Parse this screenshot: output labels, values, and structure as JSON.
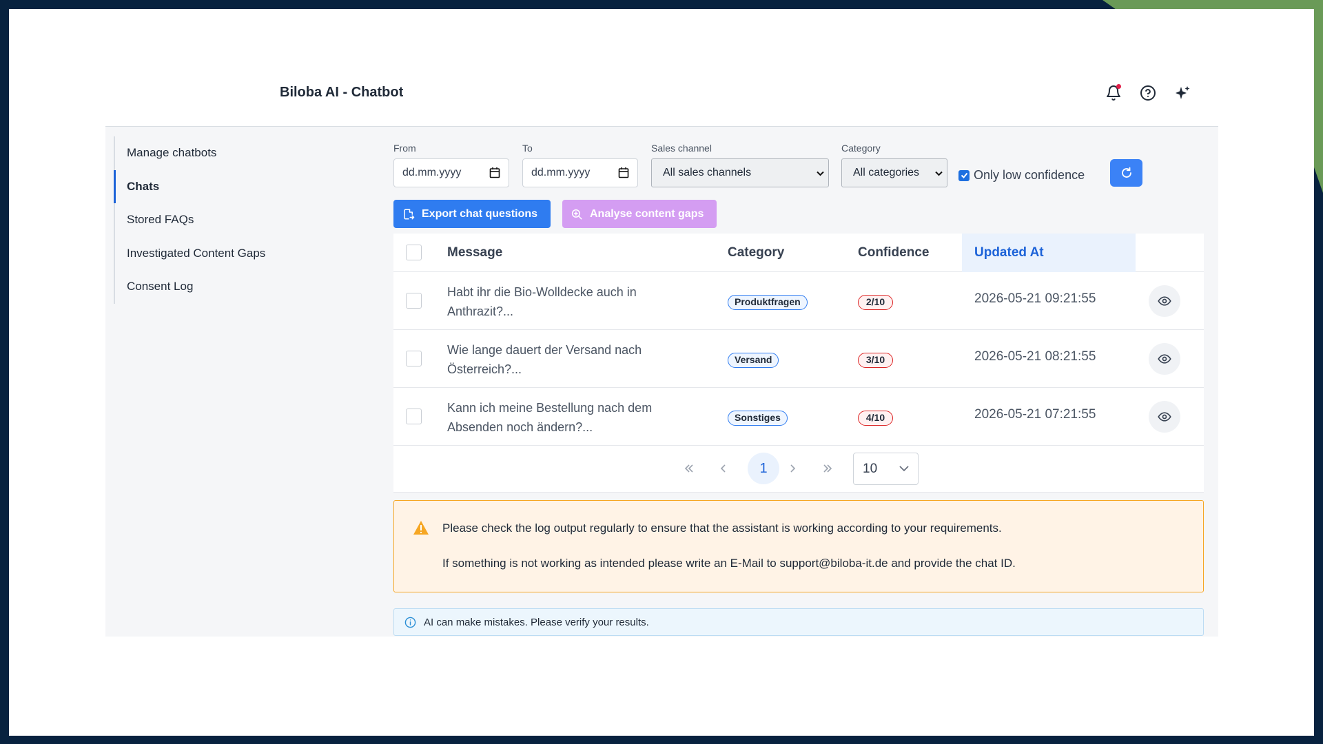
{
  "app": {
    "title": "Biloba AI - Chatbot"
  },
  "header": {
    "icons": [
      "bell-icon",
      "help-circle-icon",
      "sparkles-icon"
    ]
  },
  "sidebar": {
    "items": [
      {
        "label": "Manage chatbots",
        "active": false
      },
      {
        "label": "Chats",
        "active": true
      },
      {
        "label": "Stored FAQs",
        "active": false
      },
      {
        "label": "Investigated Content Gaps",
        "active": false
      },
      {
        "label": "Consent Log",
        "active": false
      }
    ]
  },
  "filters": {
    "from_label": "From",
    "from_placeholder": "dd.mm.yyyy",
    "to_label": "To",
    "to_placeholder": "dd.mm.yyyy",
    "sales_channel_label": "Sales channel",
    "sales_channel_value": "All sales channels",
    "category_label": "Category",
    "category_value": "All categories",
    "low_confidence_label": "Only low confidence",
    "low_confidence_checked": true
  },
  "actions": {
    "export_label": "Export chat questions",
    "analyse_label": "Analyse content gaps"
  },
  "table": {
    "headers": {
      "message": "Message",
      "category": "Category",
      "confidence": "Confidence",
      "updated_at": "Updated At"
    },
    "rows": [
      {
        "message": "Habt ihr die Bio-Wolldecke auch in Anthrazit?...",
        "category": "Produktfragen",
        "confidence": "2/10",
        "updated_at": "2026-05-21 09:21:55"
      },
      {
        "message": "Wie lange dauert der Versand nach Österreich?...",
        "category": "Versand",
        "confidence": "3/10",
        "updated_at": "2026-05-21 08:21:55"
      },
      {
        "message": "Kann ich meine Bestellung nach dem Absenden noch ändern?...",
        "category": "Sonstiges",
        "confidence": "4/10",
        "updated_at": "2026-05-21 07:21:55"
      }
    ]
  },
  "pagination": {
    "current_page": "1",
    "page_size": "10"
  },
  "notices": {
    "warning_line1": "Please check the log output regularly to ensure that the assistant is working according to your requirements.",
    "warning_line2": "If something is not working as intended please write an E-Mail to support@biloba-it.de and provide the chat ID.",
    "info": "AI can make mistakes. Please verify your results."
  },
  "colors": {
    "primary": "#2f7cf0",
    "accent_disabled": "#d49df2",
    "danger": "#dc2626",
    "warning": "#f6a623"
  }
}
